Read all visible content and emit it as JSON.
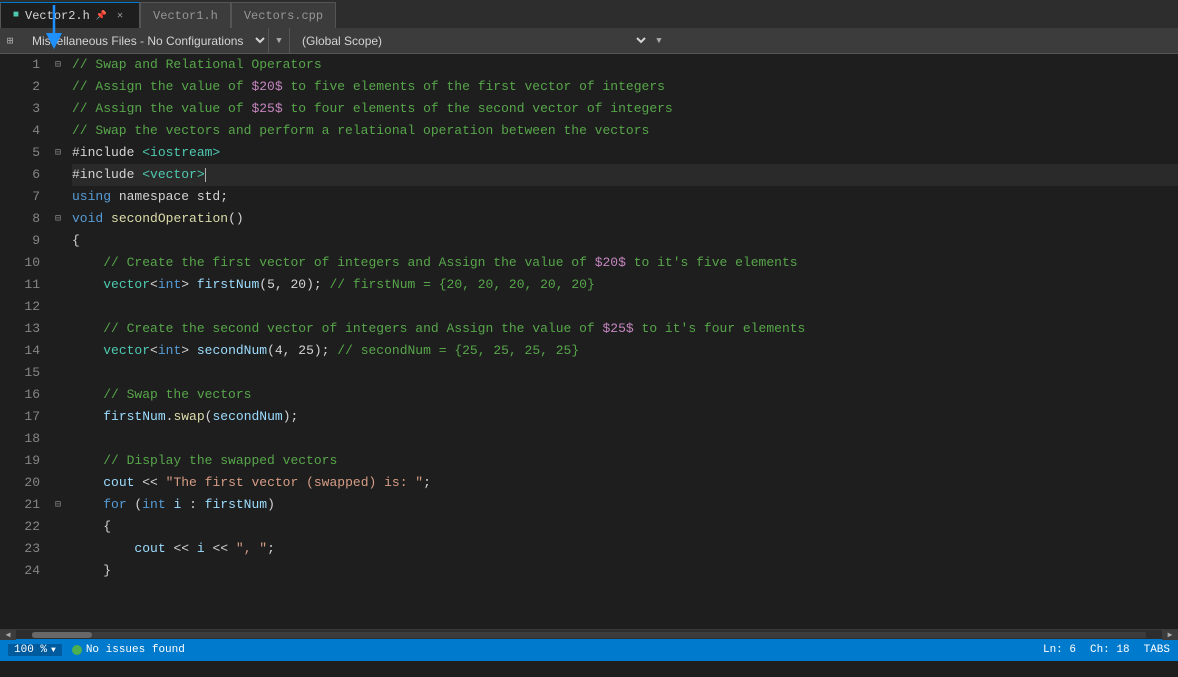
{
  "tabs": [
    {
      "label": "Vector2.h",
      "active": true,
      "pinned": true,
      "modified": false
    },
    {
      "label": "Vector1.h",
      "active": false,
      "pinned": false,
      "modified": false
    },
    {
      "label": "Vectors.cpp",
      "active": false,
      "pinned": false,
      "modified": false
    }
  ],
  "toolbar": {
    "scope_left": "Miscellaneous Files - No Configurations",
    "scope_right": "(Global Scope)"
  },
  "status": {
    "zoom": "100 %",
    "issues": "No issues found",
    "ln": "Ln: 6",
    "ch": "Ch: 18",
    "tabs": "TABS"
  },
  "lines": [
    {
      "num": "1",
      "content": "comment_header"
    },
    {
      "num": "2",
      "content": "comment_assign20"
    },
    {
      "num": "3",
      "content": "comment_assign25"
    },
    {
      "num": "4",
      "content": "comment_swap"
    },
    {
      "num": "5",
      "content": "include_iostream"
    },
    {
      "num": "6",
      "content": "include_vector"
    },
    {
      "num": "7",
      "content": "using_namespace"
    },
    {
      "num": "8",
      "content": "void_secondOp"
    },
    {
      "num": "9",
      "content": "open_brace"
    },
    {
      "num": "10",
      "content": "comment_create_first"
    },
    {
      "num": "11",
      "content": "vector_firstNum"
    },
    {
      "num": "12",
      "content": "empty"
    },
    {
      "num": "13",
      "content": "comment_create_second"
    },
    {
      "num": "14",
      "content": "vector_secondNum"
    },
    {
      "num": "15",
      "content": "empty"
    },
    {
      "num": "16",
      "content": "comment_swap_vectors"
    },
    {
      "num": "17",
      "content": "firstNum_swap"
    },
    {
      "num": "18",
      "content": "empty"
    },
    {
      "num": "19",
      "content": "comment_display"
    },
    {
      "num": "20",
      "content": "cout_first"
    },
    {
      "num": "21",
      "content": "for_loop"
    },
    {
      "num": "22",
      "content": "open_brace2"
    },
    {
      "num": "23",
      "content": "cout_i"
    },
    {
      "num": "24",
      "content": "close_brace_partial"
    }
  ]
}
